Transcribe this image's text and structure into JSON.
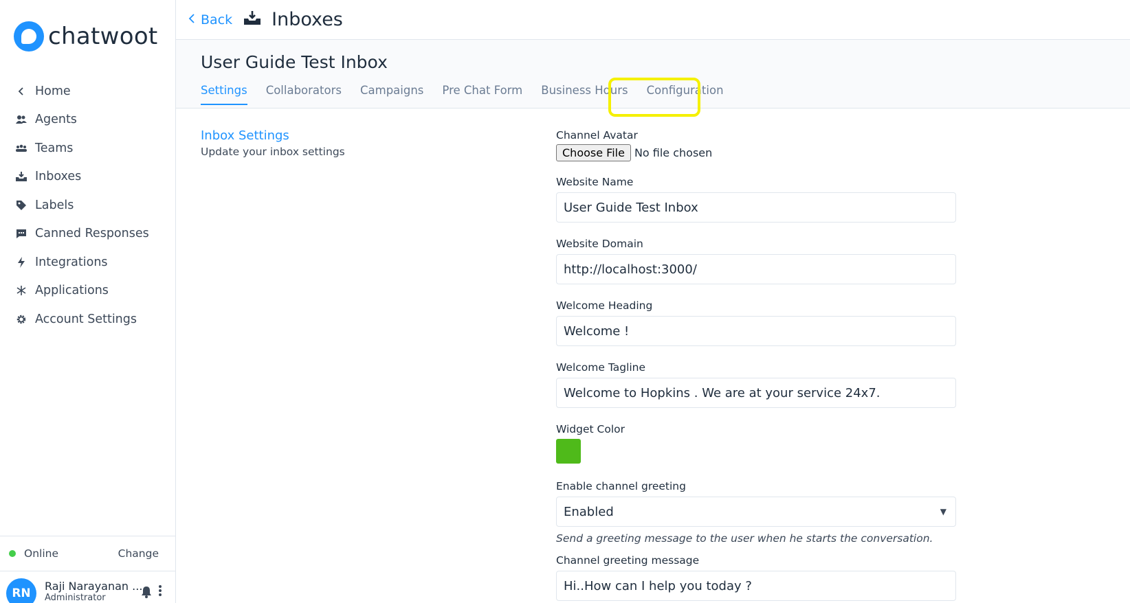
{
  "app": {
    "logo_text": "chatwoot"
  },
  "sidebar": {
    "items": [
      {
        "label": "Home",
        "icon": "chevron-left-icon"
      },
      {
        "label": "Agents",
        "icon": "agents-icon"
      },
      {
        "label": "Teams",
        "icon": "teams-icon"
      },
      {
        "label": "Inboxes",
        "icon": "inbox-icon"
      },
      {
        "label": "Labels",
        "icon": "tag-icon"
      },
      {
        "label": "Canned Responses",
        "icon": "chat-bubble-icon"
      },
      {
        "label": "Integrations",
        "icon": "lightning-icon"
      },
      {
        "label": "Applications",
        "icon": "asterisk-icon"
      },
      {
        "label": "Account Settings",
        "icon": "gear-icon"
      }
    ],
    "status": {
      "text": "Online",
      "change_label": "Change",
      "color": "#44ce4b"
    },
    "profile": {
      "initials": "RN",
      "name": "Raji Narayanan ...",
      "role": "Administrator"
    }
  },
  "header": {
    "back_label": "Back",
    "title": "Inboxes"
  },
  "inbox": {
    "title": "User Guide Test Inbox",
    "tabs": [
      {
        "label": "Settings",
        "active": true
      },
      {
        "label": "Collaborators",
        "active": false
      },
      {
        "label": "Campaigns",
        "active": false
      },
      {
        "label": "Pre Chat Form",
        "active": false
      },
      {
        "label": "Business Hours",
        "active": false
      },
      {
        "label": "Configuration",
        "active": false
      }
    ]
  },
  "settings": {
    "section_title": "Inbox Settings",
    "section_sub": "Update your inbox settings",
    "channel_avatar": {
      "label": "Channel Avatar",
      "button": "Choose File",
      "status": "No file chosen"
    },
    "website_name": {
      "label": "Website Name",
      "value": "User Guide Test Inbox"
    },
    "website_domain": {
      "label": "Website Domain",
      "value": "http://localhost:3000/"
    },
    "welcome_heading": {
      "label": "Welcome Heading",
      "value": "Welcome !"
    },
    "welcome_tagline": {
      "label": "Welcome Tagline",
      "value": "Welcome to Hopkins . We are at your service 24x7."
    },
    "widget_color": {
      "label": "Widget Color",
      "value": "#4fba1a"
    },
    "channel_greeting": {
      "label": "Enable channel greeting",
      "value": "Enabled",
      "help": "Send a greeting message to the user when he starts the conversation."
    },
    "greeting_message": {
      "label": "Channel greeting message",
      "value": "Hi..How can I help you today ?"
    }
  },
  "colors": {
    "accent": "#1f93ff",
    "highlight": "#f5f000"
  }
}
